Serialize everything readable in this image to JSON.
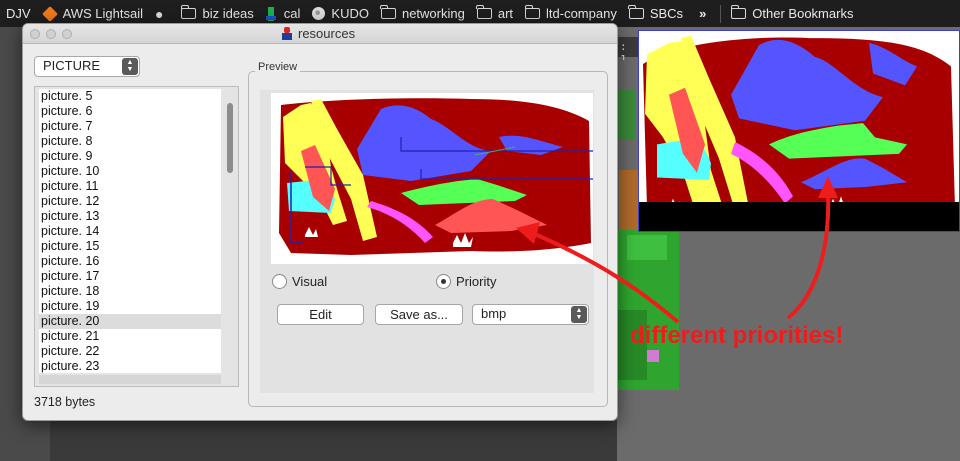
{
  "bookmarks": {
    "items": [
      {
        "label": "DJV",
        "icon": ""
      },
      {
        "label": "AWS Lightsail",
        "icon": "aws-cube-icon"
      },
      {
        "label": "",
        "icon": "apple-icon"
      },
      {
        "label": "biz ideas",
        "icon": "folder-icon"
      },
      {
        "label": "cal",
        "icon": "calendar-icon"
      },
      {
        "label": "KUDO",
        "icon": "globe-icon"
      },
      {
        "label": "networking",
        "icon": "folder-icon"
      },
      {
        "label": "art",
        "icon": "folder-icon"
      },
      {
        "label": "ltd-company",
        "icon": "folder-icon"
      },
      {
        "label": "SBCs",
        "icon": "folder-icon"
      }
    ],
    "more": "»",
    "other": "Other Bookmarks"
  },
  "window": {
    "title": "resources",
    "type_select": "PICTURE",
    "list": [
      "picture.  5",
      "picture.  6",
      "picture.  7",
      "picture.  8",
      "picture.  9",
      "picture. 10",
      "picture. 11",
      "picture. 12",
      "picture. 13",
      "picture. 14",
      "picture. 15",
      "picture. 16",
      "picture. 17",
      "picture. 18",
      "picture. 19",
      "picture. 20",
      "picture. 21",
      "picture. 22",
      "picture. 23"
    ],
    "selected_item": "picture. 20",
    "bytes": "3718 bytes",
    "preview": {
      "legend": "Preview",
      "radio_visual": "Visual",
      "radio_priority": "Priority",
      "selected_mode": "Priority",
      "edit": "Edit",
      "save_as": "Save as...",
      "format": "bmp"
    }
  },
  "background": {
    "terminal_fragment": ": 1"
  },
  "annotation": {
    "text": "different priorities!",
    "color": "#ee1c1c"
  },
  "colors": {
    "dark_red": "#a80000",
    "yellow": "#ffff55",
    "blue": "#5555ff",
    "green": "#55ff55",
    "cyan": "#55ffff",
    "pink": "#ff55ff",
    "light_red": "#ff5555"
  }
}
